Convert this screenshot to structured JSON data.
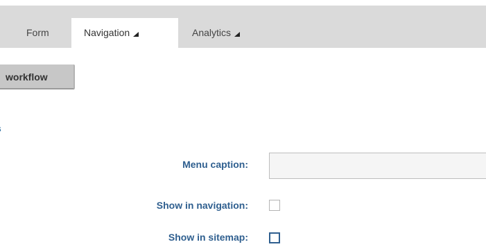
{
  "tabs": [
    {
      "label": "Form"
    },
    {
      "label": "Navigation",
      "active": true
    },
    {
      "label": "Analytics"
    }
  ],
  "toolbar": {
    "workflow_label": "workflow"
  },
  "section": {
    "heading_fragment": "s"
  },
  "form": {
    "menu_caption": {
      "label": "Menu caption:",
      "value": ""
    },
    "show_in_navigation": {
      "label": "Show in navigation:",
      "checked": false
    },
    "show_in_sitemap": {
      "label": "Show in sitemap:",
      "checked": false
    }
  },
  "colors": {
    "tab_bar_bg": "#dadada",
    "label_blue": "#2f5f8f",
    "button_bg": "#c7c7c7"
  }
}
